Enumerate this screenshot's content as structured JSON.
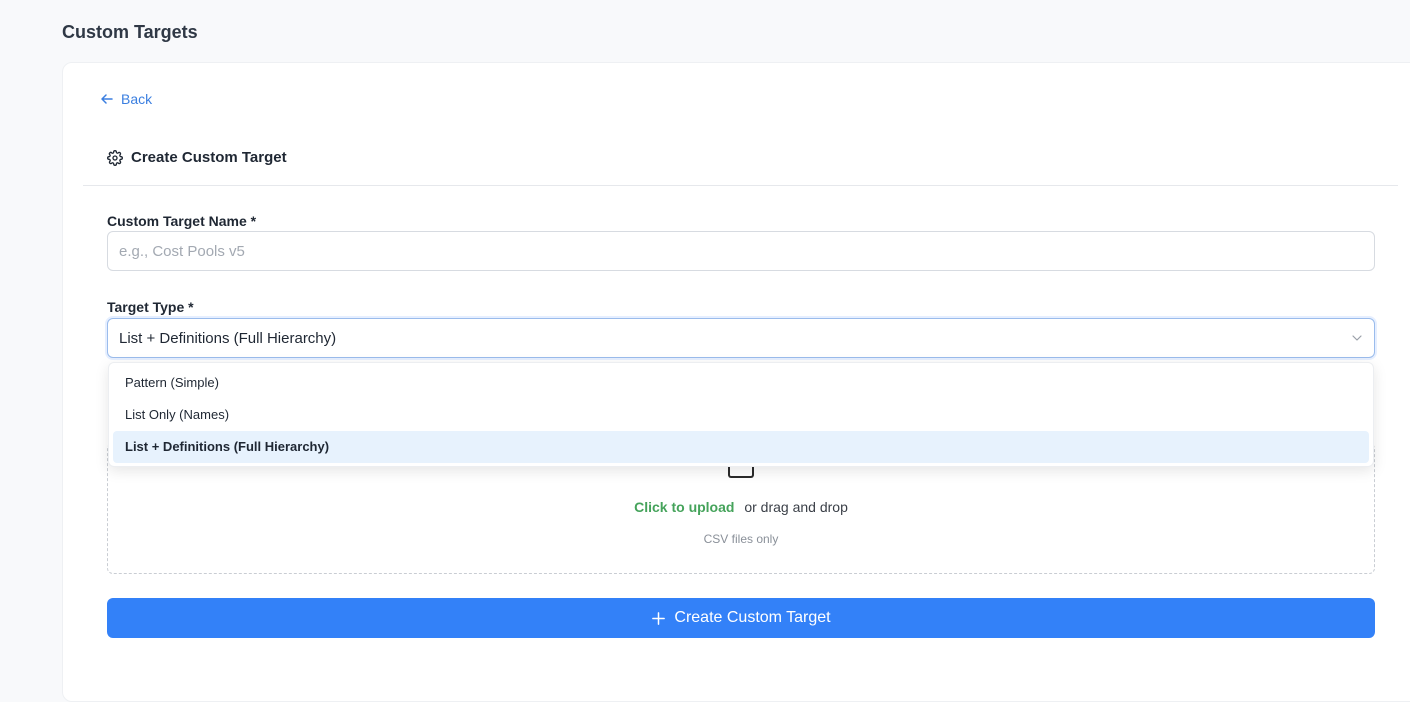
{
  "page": {
    "title": "Custom Targets"
  },
  "card": {
    "back_label": "Back",
    "section_title": "Create Custom Target",
    "name_field": {
      "label": "Custom Target Name *",
      "placeholder": "e.g., Cost Pools v5",
      "value": ""
    },
    "type_field": {
      "label": "Target Type *",
      "selected": "List + Definitions (Full Hierarchy)",
      "options": [
        "Pattern (Simple)",
        "List Only (Names)",
        "List + Definitions (Full Hierarchy)"
      ],
      "selected_index": 2
    },
    "upload": {
      "link_text": "Click to upload",
      "rest_text": "or drag and drop",
      "hint": "CSV files only"
    },
    "submit_label": "Create Custom Target"
  },
  "colors": {
    "accent": "#3381f8",
    "link": "#3b7fe0",
    "upload_link": "#45a35b",
    "selected_option_bg": "#e7f2fd"
  }
}
